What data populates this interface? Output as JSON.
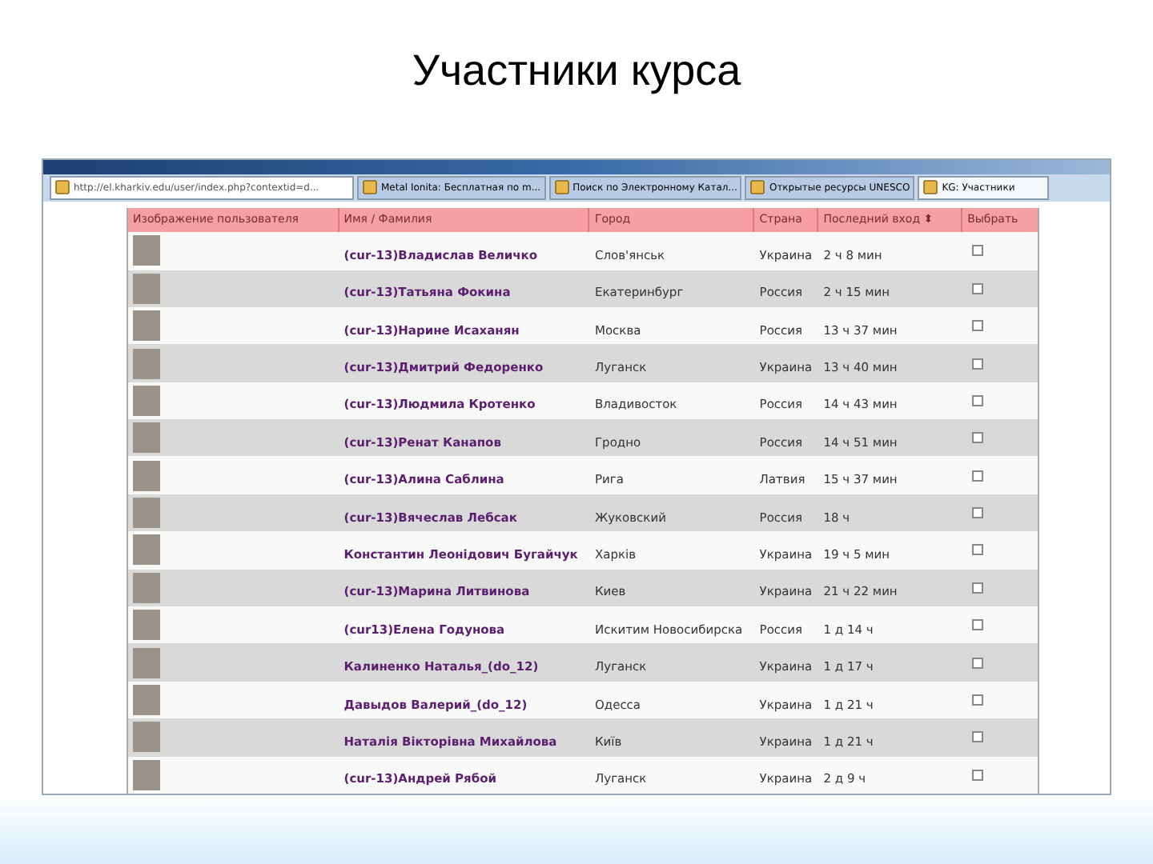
{
  "slide_title": "Участники курса",
  "browser": {
    "address": "http://el.kharkiv.edu/user/index.php?contextid=d...",
    "tabs": [
      {
        "label": "Metal Ionita: Бесплатная по m...",
        "selected": false
      },
      {
        "label": "Поиск по Электронному Катал...",
        "selected": false
      },
      {
        "label": "Открытые ресурсы UNESCO",
        "selected": false
      },
      {
        "label": "KG: Участники",
        "selected": true
      }
    ]
  },
  "table": {
    "columns": [
      "Изображение пользователя",
      "Имя / Фамилия",
      "Город",
      "Страна",
      "Последний вход ⬍",
      "Выбрать"
    ],
    "rows": [
      {
        "name": "(cur-13)Владислав Величко",
        "city": "Слов'янськ",
        "country": "Украина",
        "last": "2 ч 8 мин",
        "checked": false
      },
      {
        "name": "(cur-13)Татьяна Фокина",
        "city": "Екатеринбург",
        "country": "Россия",
        "last": "2 ч 15 мин",
        "checked": false
      },
      {
        "name": "(cur-13)Нарине Исаханян",
        "city": "Москва",
        "country": "Россия",
        "last": "13 ч 37 мин",
        "checked": false
      },
      {
        "name": "(cur-13)Дмитрий Федоренко",
        "city": "Луганск",
        "country": "Украина",
        "last": "13 ч 40 мин",
        "checked": false
      },
      {
        "name": "(cur-13)Людмила Кротенко",
        "city": "Владивосток",
        "country": "Россия",
        "last": "14 ч 43 мин",
        "checked": false
      },
      {
        "name": "(cur-13)Ренат Канапов",
        "city": "Гродно",
        "country": "Россия",
        "last": "14 ч 51 мин",
        "checked": false
      },
      {
        "name": "(cur-13)Алина Саблина",
        "city": "Рига",
        "country": "Латвия",
        "last": "15 ч 37 мин",
        "checked": false
      },
      {
        "name": "(cur-13)Вячеслав Лебсак",
        "city": "Жуковский",
        "country": "Россия",
        "last": "18 ч",
        "checked": false
      },
      {
        "name": "Константин Леонідович Бугайчук",
        "city": "Харків",
        "country": "Украина",
        "last": "19 ч 5 мин",
        "checked": false
      },
      {
        "name": "(cur-13)Марина Литвинова",
        "city": "Киев",
        "country": "Украина",
        "last": "21 ч 22 мин",
        "checked": false
      },
      {
        "name": "(cur13)Елена Годунова",
        "city": "Искитим Новосибирска",
        "country": "Россия",
        "last": "1 д 14 ч",
        "checked": false
      },
      {
        "name": "Калиненко Наталья_(do_12)",
        "city": "Луганск",
        "country": "Украина",
        "last": "1 д 17 ч",
        "checked": false
      },
      {
        "name": "Давыдов Валерий_(do_12)",
        "city": "Одесса",
        "country": "Украина",
        "last": "1 д 21 ч",
        "checked": false
      },
      {
        "name": "Наталія Вікторівна Михайлова",
        "city": "Київ",
        "country": "Украина",
        "last": "1 д 21 ч",
        "checked": false
      },
      {
        "name": "(cur-13)Андрей Рябой",
        "city": "Луганск",
        "country": "Украина",
        "last": "2 д 9 ч",
        "checked": false
      }
    ]
  }
}
